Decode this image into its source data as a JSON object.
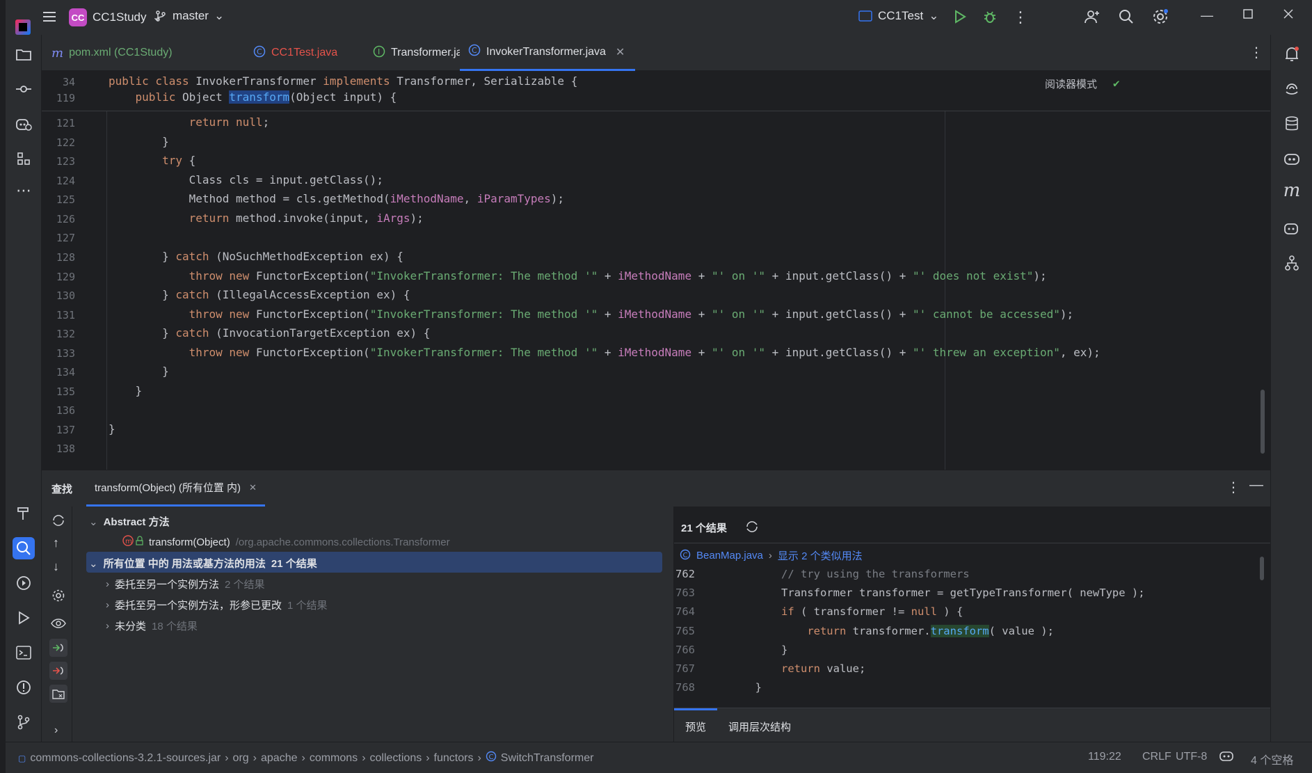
{
  "titlebar": {
    "project_initials": "CC",
    "project_name": "CC1Study",
    "branch": "master",
    "run_config": "CC1Test"
  },
  "tabs": [
    {
      "label": "pom.xml (CC1Study)",
      "icon": "maven-icon"
    },
    {
      "label": "CC1Test.java",
      "icon": "class-icon"
    },
    {
      "label": "Transformer.java",
      "icon": "interface-icon"
    },
    {
      "label": "InvokerTransformer.java",
      "icon": "class-icon",
      "active": true
    }
  ],
  "editor": {
    "reader_mode": "阅读器模式",
    "sticky": [
      {
        "num": "34",
        "pre": "public class ",
        "name": "InvokerTransformer ",
        "mid": "implements ",
        "rest": "Transformer, Serializable {"
      },
      {
        "num": "119",
        "pre": "    public ",
        "type": "Object ",
        "method": "transform",
        "rest": "(Object input) {"
      }
    ],
    "lines": [
      {
        "num": "121"
      },
      {
        "num": "122"
      },
      {
        "num": "123"
      },
      {
        "num": "124"
      },
      {
        "num": "125"
      },
      {
        "num": "126"
      },
      {
        "num": "127"
      },
      {
        "num": "128"
      },
      {
        "num": "129"
      },
      {
        "num": "130"
      },
      {
        "num": "131"
      },
      {
        "num": "132"
      },
      {
        "num": "133"
      },
      {
        "num": "134"
      },
      {
        "num": "135"
      },
      {
        "num": "136"
      },
      {
        "num": "137"
      },
      {
        "num": "138"
      }
    ]
  },
  "find_panel": {
    "title": "查找",
    "tab_label": "transform(Object) (所有位置 内)",
    "tree": {
      "abstract_label": "Abstract 方法",
      "abstract_item": "transform(Object)",
      "abstract_item_path": "/org.apache.commons.collections.Transformer",
      "usages_label": "所有位置 中的 用法或基方法的用法",
      "usages_count": "21 个结果",
      "children": [
        {
          "label": "委托至另一个实例方法",
          "count": "2 个结果"
        },
        {
          "label": "委托至另一个实例方法，形参已更改",
          "count": "1 个结果"
        },
        {
          "label": "未分类",
          "count": "18 个结果"
        }
      ]
    },
    "preview": {
      "results": "21 个结果",
      "file": "BeanMap.java",
      "similar": "显示 2 个类似用法",
      "lines": [
        "762",
        "763",
        "764",
        "765",
        "766",
        "767",
        "768"
      ],
      "tab_preview": "预览",
      "tab_hierarchy": "调用层次结构"
    }
  },
  "status": {
    "crumbs": [
      "commons-collections-3.2.1-sources.jar",
      "org",
      "apache",
      "commons",
      "collections",
      "functors",
      "SwitchTransformer"
    ],
    "position": "119:22",
    "line_sep": "CRLF",
    "encoding": "UTF-8",
    "indent": "4 个空格"
  },
  "colors": {
    "accent": "#3574f0",
    "keyword": "#cf8e6d",
    "string": "#6aab73",
    "field": "#c77dbb"
  }
}
